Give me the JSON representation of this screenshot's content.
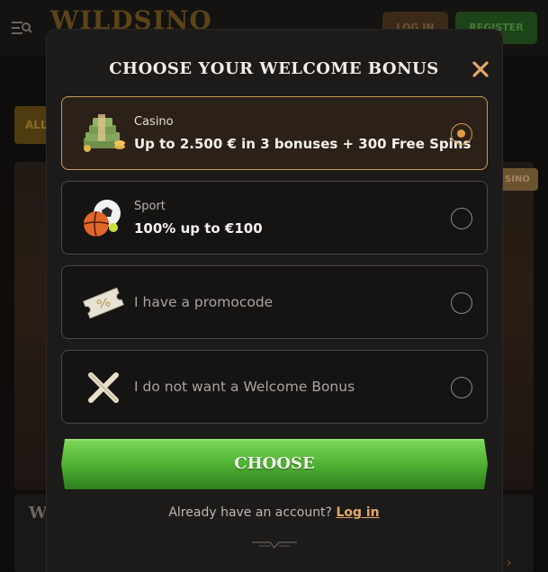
{
  "background": {
    "logo": "WILDSINO",
    "login_label": "LOG IN",
    "register_label": "REGISTER",
    "tab_label": "ALL",
    "badge_label": "SINO",
    "game_title": "WI"
  },
  "modal": {
    "title": "CHOOSE YOUR WELCOME BONUS",
    "close_icon": "close-icon",
    "options": [
      {
        "label": "Casino",
        "value": "Up to 2.500 € in 3 bonuses + 300 Free Spins",
        "icon": "money-stack-icon",
        "selected": true
      },
      {
        "label": "Sport",
        "value": "100% up to €100",
        "icon": "sports-balls-icon",
        "selected": false
      },
      {
        "label": "I have a promocode",
        "icon": "ticket-icon",
        "selected": false
      },
      {
        "label": "I do not want a Welcome Bonus",
        "icon": "cross-icon",
        "selected": false
      }
    ],
    "choose_label": "CHOOSE",
    "already_text": "Already have an account?",
    "login_link": "Log in"
  },
  "colors": {
    "accent": "#e39a45",
    "button_green": "#4caf32",
    "selected_border": "#c99a54"
  }
}
